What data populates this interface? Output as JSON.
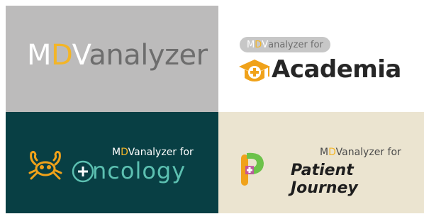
{
  "brand": {
    "m": "M",
    "d": "D",
    "v": "V",
    "rest": "analyzer"
  },
  "panels": [
    {
      "brand_suffix": "",
      "subtitle": ""
    },
    {
      "brand_suffix": " for",
      "subtitle": "Academia",
      "icon": "graduation-cap-plus-icon"
    },
    {
      "brand_suffix": " for",
      "subtitle": "ncology",
      "icon": "crab-icon"
    },
    {
      "brand_suffix": " for",
      "subtitle": "Patient Journey",
      "icon": "patient-journey-icon"
    }
  ],
  "colors": {
    "brand_d": "#f3b527",
    "gray_panel": "#bcbbbb",
    "teal_panel": "#083f44",
    "teal_text": "#5cc0b1",
    "beige_panel": "#ebe4d0",
    "orange_icon": "#f0a21a"
  }
}
